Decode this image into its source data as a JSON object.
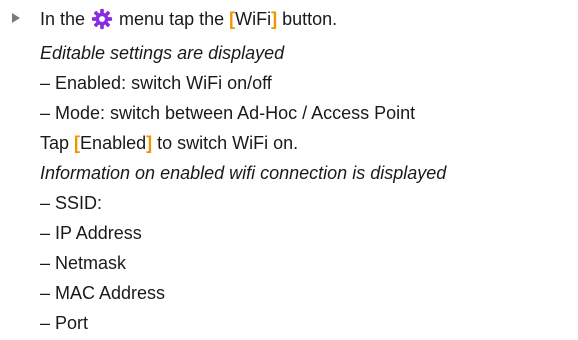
{
  "colors": {
    "bracket": "#f29400",
    "gear_icon": "#8a2be2",
    "bullet": "#7a7a7a",
    "text": "#1a1a1a"
  },
  "step": {
    "intro_prefix": "In the",
    "gear_icon": "gear-icon",
    "intro_middle": "menu tap the",
    "button_open": "[",
    "button_label": "WiFi",
    "button_close": "]",
    "intro_suffix": "button."
  },
  "editable": {
    "note": "Editable settings are displayed",
    "items": [
      "– Enabled: switch WiFi on/off",
      "– Mode: switch between Ad-Hoc / Access Point"
    ]
  },
  "enable": {
    "prefix": "Tap",
    "button_open": "[",
    "button_label": "Enabled",
    "button_close": "]",
    "suffix": "to switch WiFi on."
  },
  "info": {
    "note": "Information on enabled wifi connection is displayed",
    "items": [
      "– SSID:",
      "– IP Address",
      "– Netmask",
      "– MAC Address",
      "– Port"
    ]
  }
}
